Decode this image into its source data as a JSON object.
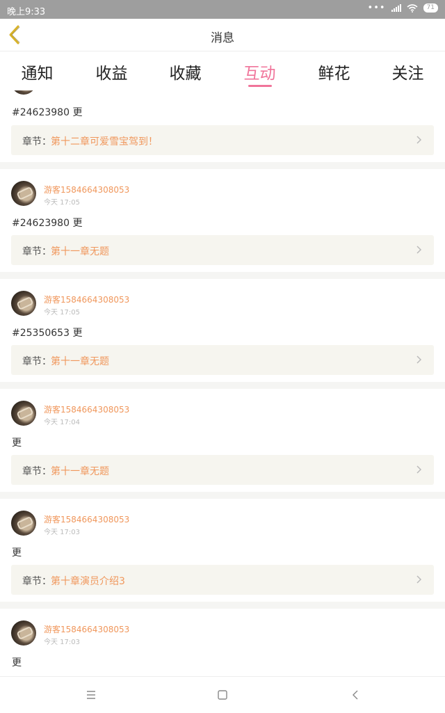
{
  "status_bar": {
    "time": "晚上9:33",
    "battery": "71"
  },
  "header": {
    "title": "消息"
  },
  "tabs": [
    {
      "label": "通知",
      "active": false
    },
    {
      "label": "收益",
      "active": false
    },
    {
      "label": "收藏",
      "active": false
    },
    {
      "label": "互动",
      "active": true
    },
    {
      "label": "鲜花",
      "active": false
    },
    {
      "label": "关注",
      "active": false
    }
  ],
  "chapter_label": "章节：",
  "feed": [
    {
      "username": "",
      "time": "",
      "text": "#24623980 更",
      "chapter": "第十二章可爱雪宝驾到！"
    },
    {
      "username": "游客1584664308053",
      "time": "今天 17:05",
      "text": "#24623980 更",
      "chapter": "第十一章无题"
    },
    {
      "username": "游客1584664308053",
      "time": "今天 17:05",
      "text": "#25350653 更",
      "chapter": "第十一章无题"
    },
    {
      "username": "游客1584664308053",
      "time": "今天 17:04",
      "text": "更",
      "chapter": "第十一章无题"
    },
    {
      "username": "游客1584664308053",
      "time": "今天 17:03",
      "text": "更",
      "chapter": "第十章演员介绍3"
    },
    {
      "username": "游客1584664308053",
      "time": "今天 17:03",
      "text": "更",
      "chapter": ""
    }
  ],
  "colors": {
    "accent": "#f0749a",
    "username": "#f0975c",
    "back_icon": "#d8b32a"
  }
}
